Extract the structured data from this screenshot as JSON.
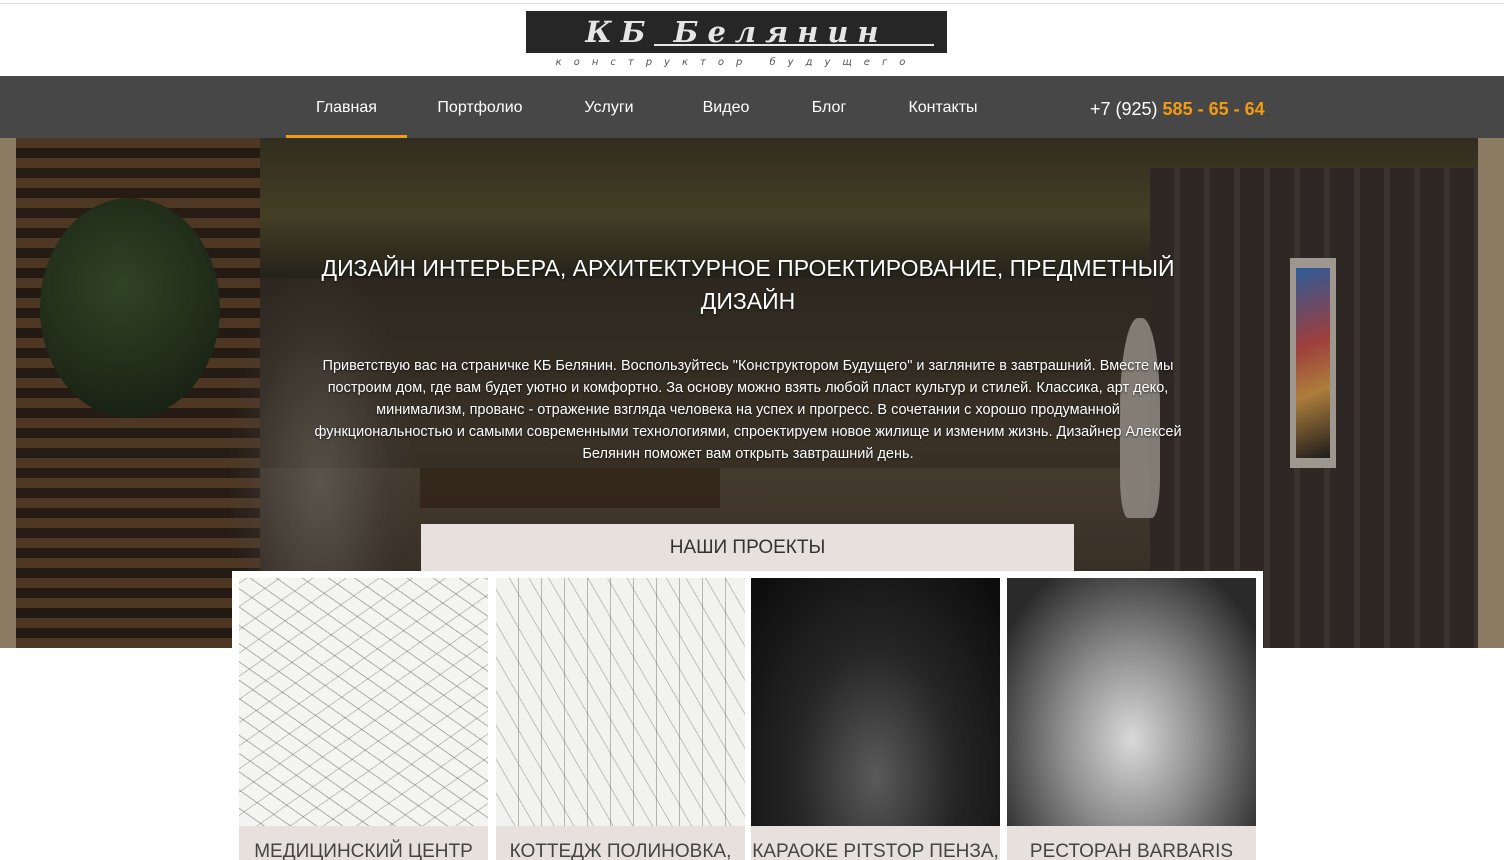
{
  "brand": {
    "logo_title": "КБ Белянин",
    "logo_subtitle": "конструктор будущего"
  },
  "nav": {
    "items": [
      "Главная",
      "Портфолио",
      "Услуги",
      "Видео",
      "Блог",
      "Контакты"
    ],
    "active_index": 0,
    "phone_prefix": "+7 (925) ",
    "phone_number": "585 - 65 - 64"
  },
  "hero": {
    "title": "ДИЗАЙН ИНТЕРЬЕРА, АРХИТЕКТУРНОЕ ПРОЕКТИРОВАНИЕ, ПРЕДМЕТНЫЙ ДИЗАЙН",
    "text": "Приветствую вас на страничке КБ Белянин. Воспользуйтесь \"Конструктором Будущего\" и загляните в завтрашний. Вместе мы построим дом, где вам будет уютно и комфортно. За основу можно взять любой пласт культур и стилей. Классика, арт деко, минимализм, прованс - отражение взгляда человека на успех и прогресс. В сочетании с хорошо продуманной функциональностью и самыми современными технологиями, спроектируем новое жилище и изменим жизнь. Дизайнер Алексей Белянин поможет вам открыть завтрашний день."
  },
  "projects": {
    "heading": "НАШИ ПРОЕКТЫ",
    "cards": [
      {
        "caption": "МЕДИЦИНСКИЙ ЦЕНТР"
      },
      {
        "caption": "КОТТЕДЖ ПОЛИНОВКА,"
      },
      {
        "caption": "КАРАОКЕ PITSTOP ПЕНЗА,"
      },
      {
        "caption": "РЕСТОРАН BARBARIS"
      }
    ]
  },
  "colors": {
    "accent": "#f39c12",
    "nav_bg": "#474747",
    "caption_bg": "#e6e1dd"
  }
}
